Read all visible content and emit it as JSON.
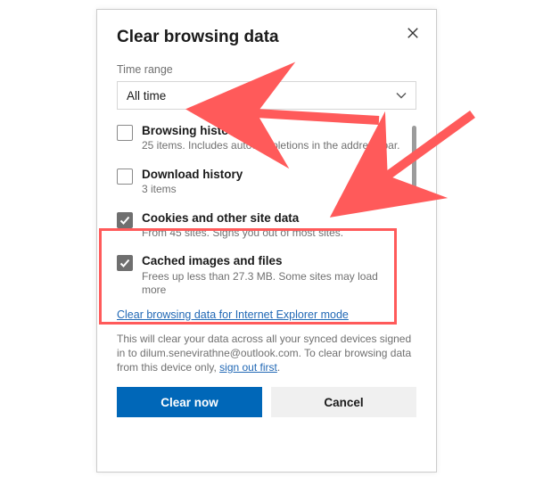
{
  "dialog": {
    "title": "Clear browsing data",
    "time_range": {
      "label": "Time range",
      "selected": "All time"
    },
    "options": [
      {
        "id": "browsing-history",
        "label": "Browsing history",
        "desc": "25 items. Includes autocompletions in the address bar.",
        "checked": false
      },
      {
        "id": "download-history",
        "label": "Download history",
        "desc": "3 items",
        "checked": false
      },
      {
        "id": "cookies",
        "label": "Cookies and other site data",
        "desc": "From 45 sites. Signs you out of most sites.",
        "checked": true
      },
      {
        "id": "cache",
        "label": "Cached images and files",
        "desc": "Frees up less than 27.3 MB. Some sites may load more",
        "checked": true
      }
    ],
    "ie_mode_link": "Clear browsing data for Internet Explorer mode",
    "footnote_prefix": "This will clear your data across all your synced devices signed in to ",
    "footnote_email": "dilum.senevirathne@outlook.com",
    "footnote_mid": ". To clear browsing data from this device only, ",
    "footnote_link": "sign out first",
    "footnote_suffix": ".",
    "buttons": {
      "primary": "Clear now",
      "secondary": "Cancel"
    }
  },
  "annotation": {
    "highlight_box": true,
    "arrows": 2,
    "color": "#ff5a5a"
  }
}
